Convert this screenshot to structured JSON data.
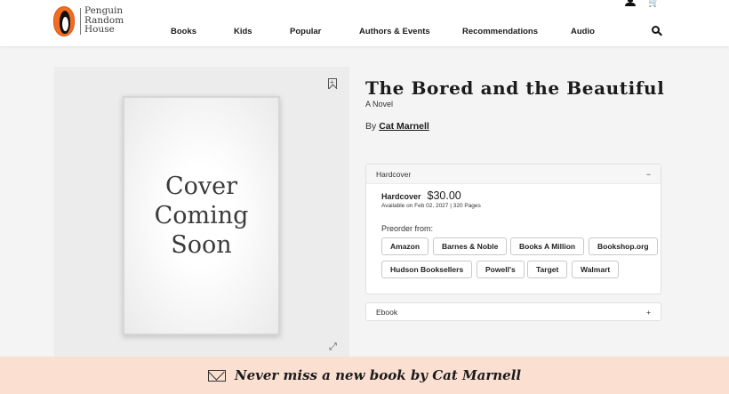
{
  "brand": {
    "logo_lines": [
      "Penguin",
      "Random",
      "House"
    ]
  },
  "nav": {
    "items": [
      "Books",
      "Kids",
      "Popular",
      "Authors & Events",
      "Recommendations",
      "Audio"
    ]
  },
  "header_icons": [
    "user-icon",
    "cart-icon",
    "search-icon"
  ],
  "cover": {
    "text": "Cover\nComing\nSoon"
  },
  "book": {
    "title": "The Bored and the Beautiful",
    "subtitle": "A Novel",
    "by_prefix": "By",
    "author": "Cat Marnell"
  },
  "formats": {
    "open": {
      "header": "Hardcover",
      "toggle": "−",
      "name": "Hardcover",
      "price": "$30.00",
      "availability": "Available on Feb 02, 2027 | 320 Pages",
      "preorder_label": "Preorder from:",
      "retailers": [
        "Amazon",
        "Barnes & Noble",
        "Books A Million",
        "Bookshop.org",
        "Hudson Booksellers",
        "Powell's",
        "Target",
        "Walmart"
      ]
    },
    "collapsed": {
      "header": "Ebook",
      "toggle": "+"
    }
  },
  "newsletter": {
    "text": "Never miss a new book by Cat Marnell"
  },
  "colors": {
    "brand_orange": "#f26c21",
    "newsletter_bg": "#fbe0d2",
    "page_bg": "#f4f4f4"
  }
}
